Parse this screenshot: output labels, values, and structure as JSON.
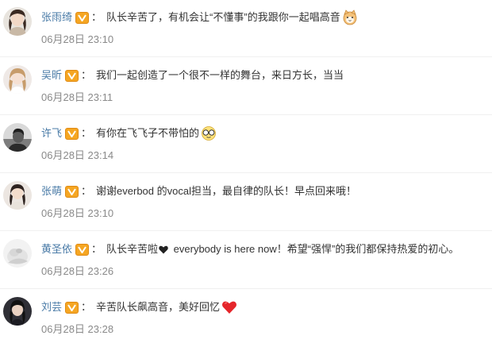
{
  "comments": [
    {
      "username": "张雨绮",
      "colon": "：",
      "text": "队长辛苦了，有机会让“不懂事”的我跟你一起唱高音",
      "emoji": "cat-emoji",
      "timestamp": "06月28日 23:10"
    },
    {
      "username": "吴昕",
      "colon": "：",
      "text": "我们一起创造了一个很不一样的舞台，来日方长，当当",
      "timestamp": "06月28日 23:11"
    },
    {
      "username": "许飞",
      "colon": "：",
      "text": "有你在飞飞子不带怕的",
      "emoji": "glasses-emoji",
      "timestamp": "06月28日 23:14"
    },
    {
      "username": "张萌",
      "colon": "：",
      "text": "谢谢everbod 的vocal担当，最自律的队长！早点回来哦！",
      "timestamp": "06月28日 23:10"
    },
    {
      "username": "黄圣依",
      "colon": "：",
      "text_before": "队长辛苦啦",
      "emoji_mid": "black-heart-emoji",
      "text_after": " everybody is here now！希望“强悍”的我们都保持热爱的初心。",
      "timestamp": "06月28日 23:26"
    },
    {
      "username": "刘芸",
      "colon": "：",
      "text": "辛苦队长飙高音，美好回忆",
      "emoji": "red-heart-emoji",
      "timestamp": "06月28日 23:28"
    }
  ],
  "colors": {
    "username": "#4a7ba7",
    "text": "#333333",
    "timestamp": "#8a8a8a",
    "vip_badge": "#f5a623",
    "divider": "#f0f0f0"
  }
}
